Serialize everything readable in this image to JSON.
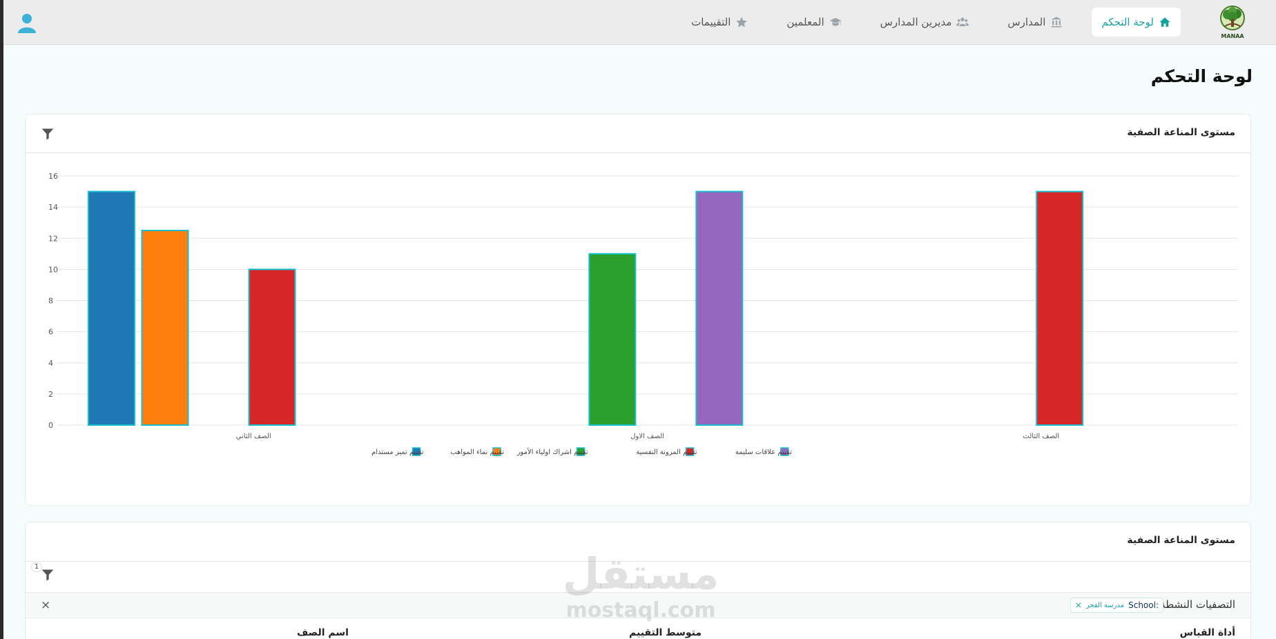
{
  "brand": {
    "logo_text": "MANAA"
  },
  "nav": {
    "items": [
      {
        "label": "لوحة التحكم",
        "icon": "home-icon",
        "active": true
      },
      {
        "label": "المدارس",
        "icon": "institution-icon",
        "active": false
      },
      {
        "label": "مديرين المدارس",
        "icon": "users-icon",
        "active": false
      },
      {
        "label": "المعلمين",
        "icon": "graduation-cap-icon",
        "active": false
      },
      {
        "label": "التقييمات",
        "icon": "star-icon",
        "active": false
      }
    ]
  },
  "page": {
    "title": "لوحة التحكم"
  },
  "chart_card": {
    "title": "مستوى المناعة الصفية"
  },
  "table_card": {
    "title": "مستوى المناعة الصفية",
    "filter_count": "1",
    "active_filters_label": "التصفيات النشطة",
    "chip": {
      "key": "School:",
      "value": "مدرسة الفجر",
      "remove": "×"
    },
    "clear": "×",
    "columns": [
      "أداة القياس",
      "متوسط التقييم",
      "اسم الصف"
    ]
  },
  "watermark": {
    "arabic": "مستقل",
    "latin": "mostaql.com"
  },
  "colors": {
    "accent": "#17a2a2",
    "bar_border": "#17becf"
  },
  "chart_data": {
    "type": "bar",
    "categories": [
      "الصف الثاني",
      "الصف الاول",
      "الصف الثالث"
    ],
    "series": [
      {
        "name": "تقييم تميز مستدام",
        "color": "#1f77b4",
        "values": [
          15,
          null,
          null
        ]
      },
      {
        "name": "تقييم نماء المواهب",
        "color": "#ff7f0e",
        "values": [
          12.5,
          null,
          null
        ]
      },
      {
        "name": "تقييم اشراك اولياء الأمور",
        "color": "#2ca02c",
        "values": [
          null,
          11,
          null
        ]
      },
      {
        "name": "تقييم المرونة النفسية",
        "color": "#d62728",
        "values": [
          10,
          null,
          15
        ]
      },
      {
        "name": "تقييم علاقات سليمة",
        "color": "#9467bd",
        "values": [
          null,
          15,
          null
        ]
      }
    ],
    "ylim": [
      0,
      16
    ],
    "yticks": [
      0,
      2,
      4,
      6,
      8,
      10,
      12,
      14,
      16
    ],
    "grid": true,
    "legend": "bottom"
  }
}
